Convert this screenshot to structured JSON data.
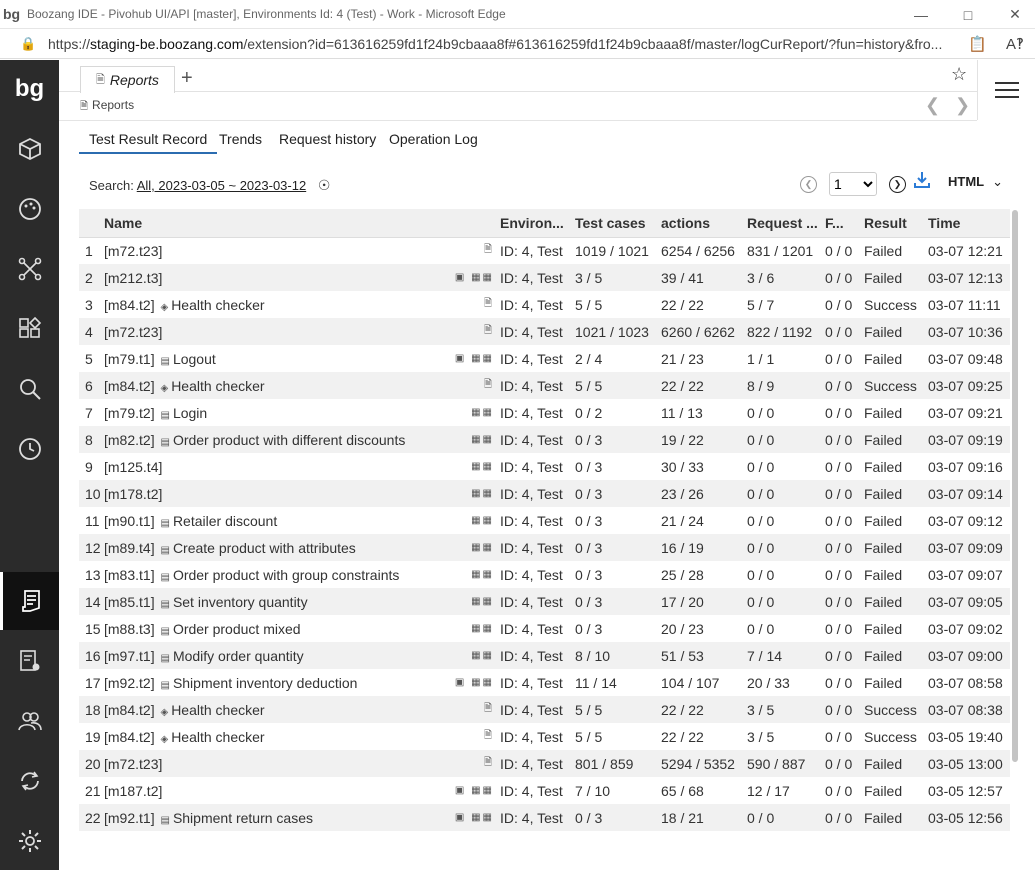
{
  "browser": {
    "title": "Boozang IDE - Pivohub UI/API [master], Environments Id: 4 (Test) - Work - Microsoft Edge",
    "url_prefix": "https://",
    "url_host": "staging-be.boozang.com",
    "url_rest": "/extension?id=613616259fd1f24b9cbaaa8f#613616259fd1f24b9cbaaa8f/master/logCurReport/?fun=history&fro..."
  },
  "app": {
    "logo": "bg",
    "tab_label": "Reports",
    "breadcrumb": "Reports"
  },
  "subtabs": [
    "Test Result Record",
    "Trends",
    "Request history",
    "Operation Log"
  ],
  "search": {
    "label": "Search:",
    "value": "All, 2023-03-05 ~ 2023-03-12"
  },
  "pager": {
    "page": "1",
    "format": "HTML"
  },
  "table": {
    "headers": [
      "Name",
      "Environ...",
      "Test cases",
      "actions",
      "Request ...",
      "F...",
      "Result",
      "Time"
    ],
    "rows": [
      {
        "n": "1",
        "code": "[m72.t23]",
        "ticon": "",
        "title": "",
        "tags": "doc",
        "env": "ID: 4, Test",
        "tc": "1019 / 1021",
        "act": "6254 / 6256",
        "req": "831 / 1201",
        "f": "0 / 0",
        "res": "Failed",
        "time": "03-07 12:21"
      },
      {
        "n": "2",
        "code": "[m212.t3]",
        "ticon": "",
        "title": "",
        "tags": "img-data",
        "env": "ID: 4, Test",
        "tc": "3 / 5",
        "act": "39 / 41",
        "req": "3 / 6",
        "f": "0 / 0",
        "res": "Failed",
        "time": "03-07 12:13"
      },
      {
        "n": "3",
        "code": "[m84.t2]",
        "ticon": "diamond",
        "title": "Health checker",
        "tags": "doc",
        "env": "ID: 4, Test",
        "tc": "5 / 5",
        "act": "22 / 22",
        "req": "5 / 7",
        "f": "0 / 0",
        "res": "Success",
        "time": "03-07 11:11"
      },
      {
        "n": "4",
        "code": "[m72.t23]",
        "ticon": "",
        "title": "",
        "tags": "doc",
        "env": "ID: 4, Test",
        "tc": "1021 / 1023",
        "act": "6260 / 6262",
        "req": "822 / 1192",
        "f": "0 / 0",
        "res": "Failed",
        "time": "03-07 10:36"
      },
      {
        "n": "5",
        "code": "[m79.t1]",
        "ticon": "card",
        "title": "Logout",
        "tags": "img-data",
        "env": "ID: 4, Test",
        "tc": "2 / 4",
        "act": "21 / 23",
        "req": "1 / 1",
        "f": "0 / 0",
        "res": "Failed",
        "time": "03-07 09:48"
      },
      {
        "n": "6",
        "code": "[m84.t2]",
        "ticon": "diamond",
        "title": "Health checker",
        "tags": "doc",
        "env": "ID: 4, Test",
        "tc": "5 / 5",
        "act": "22 / 22",
        "req": "8 / 9",
        "f": "0 / 0",
        "res": "Success",
        "time": "03-07 09:25"
      },
      {
        "n": "7",
        "code": "[m79.t2]",
        "ticon": "card",
        "title": "Login",
        "tags": "data",
        "env": "ID: 4, Test",
        "tc": "0 / 2",
        "act": "11 / 13",
        "req": "0 / 0",
        "f": "0 / 0",
        "res": "Failed",
        "time": "03-07 09:21"
      },
      {
        "n": "8",
        "code": "[m82.t2]",
        "ticon": "card",
        "title": "Order product with different discounts",
        "tags": "data",
        "env": "ID: 4, Test",
        "tc": "0 / 3",
        "act": "19 / 22",
        "req": "0 / 0",
        "f": "0 / 0",
        "res": "Failed",
        "time": "03-07 09:19"
      },
      {
        "n": "9",
        "code": "[m125.t4]",
        "ticon": "",
        "title": "",
        "tags": "data",
        "env": "ID: 4, Test",
        "tc": "0 / 3",
        "act": "30 / 33",
        "req": "0 / 0",
        "f": "0 / 0",
        "res": "Failed",
        "time": "03-07 09:16"
      },
      {
        "n": "10",
        "code": "[m178.t2]",
        "ticon": "",
        "title": "",
        "tags": "data",
        "env": "ID: 4, Test",
        "tc": "0 / 3",
        "act": "23 / 26",
        "req": "0 / 0",
        "f": "0 / 0",
        "res": "Failed",
        "time": "03-07 09:14"
      },
      {
        "n": "11",
        "code": "[m90.t1]",
        "ticon": "card",
        "title": "Retailer discount",
        "tags": "data",
        "env": "ID: 4, Test",
        "tc": "0 / 3",
        "act": "21 / 24",
        "req": "0 / 0",
        "f": "0 / 0",
        "res": "Failed",
        "time": "03-07 09:12"
      },
      {
        "n": "12",
        "code": "[m89.t4]",
        "ticon": "card",
        "title": "Create product with attributes",
        "tags": "data",
        "env": "ID: 4, Test",
        "tc": "0 / 3",
        "act": "16 / 19",
        "req": "0 / 0",
        "f": "0 / 0",
        "res": "Failed",
        "time": "03-07 09:09"
      },
      {
        "n": "13",
        "code": "[m83.t1]",
        "ticon": "card",
        "title": "Order product with group constraints",
        "tags": "data",
        "env": "ID: 4, Test",
        "tc": "0 / 3",
        "act": "25 / 28",
        "req": "0 / 0",
        "f": "0 / 0",
        "res": "Failed",
        "time": "03-07 09:07"
      },
      {
        "n": "14",
        "code": "[m85.t1]",
        "ticon": "card",
        "title": "Set inventory quantity",
        "tags": "data",
        "env": "ID: 4, Test",
        "tc": "0 / 3",
        "act": "17 / 20",
        "req": "0 / 0",
        "f": "0 / 0",
        "res": "Failed",
        "time": "03-07 09:05"
      },
      {
        "n": "15",
        "code": "[m88.t3]",
        "ticon": "card",
        "title": "Order product mixed",
        "tags": "data",
        "env": "ID: 4, Test",
        "tc": "0 / 3",
        "act": "20 / 23",
        "req": "0 / 0",
        "f": "0 / 0",
        "res": "Failed",
        "time": "03-07 09:02"
      },
      {
        "n": "16",
        "code": "[m97.t1]",
        "ticon": "card",
        "title": "Modify order quantity",
        "tags": "data",
        "env": "ID: 4, Test",
        "tc": "8 / 10",
        "act": "51 / 53",
        "req": "7 / 14",
        "f": "0 / 0",
        "res": "Failed",
        "time": "03-07 09:00"
      },
      {
        "n": "17",
        "code": "[m92.t2]",
        "ticon": "card",
        "title": "Shipment inventory deduction",
        "tags": "img-data",
        "env": "ID: 4, Test",
        "tc": "11 / 14",
        "act": "104 / 107",
        "req": "20 / 33",
        "f": "0 / 0",
        "res": "Failed",
        "time": "03-07 08:58"
      },
      {
        "n": "18",
        "code": "[m84.t2]",
        "ticon": "diamond",
        "title": "Health checker",
        "tags": "doc",
        "env": "ID: 4, Test",
        "tc": "5 / 5",
        "act": "22 / 22",
        "req": "3 / 5",
        "f": "0 / 0",
        "res": "Success",
        "time": "03-07 08:38"
      },
      {
        "n": "19",
        "code": "[m84.t2]",
        "ticon": "diamond",
        "title": "Health checker",
        "tags": "doc",
        "env": "ID: 4, Test",
        "tc": "5 / 5",
        "act": "22 / 22",
        "req": "3 / 5",
        "f": "0 / 0",
        "res": "Success",
        "time": "03-05 19:40"
      },
      {
        "n": "20",
        "code": "[m72.t23]",
        "ticon": "",
        "title": "",
        "tags": "doc",
        "env": "ID: 4, Test",
        "tc": "801 / 859",
        "act": "5294 / 5352",
        "req": "590 / 887",
        "f": "0 / 0",
        "res": "Failed",
        "time": "03-05 13:00"
      },
      {
        "n": "21",
        "code": "[m187.t2]",
        "ticon": "",
        "title": "",
        "tags": "img-data",
        "env": "ID: 4, Test",
        "tc": "7 / 10",
        "act": "65 / 68",
        "req": "12 / 17",
        "f": "0 / 0",
        "res": "Failed",
        "time": "03-05 12:57"
      },
      {
        "n": "22",
        "code": "[m92.t1]",
        "ticon": "card",
        "title": "Shipment return cases",
        "tags": "img-data",
        "env": "ID: 4, Test",
        "tc": "0 / 3",
        "act": "18 / 21",
        "req": "0 / 0",
        "f": "0 / 0",
        "res": "Failed",
        "time": "03-05 12:56"
      }
    ]
  }
}
